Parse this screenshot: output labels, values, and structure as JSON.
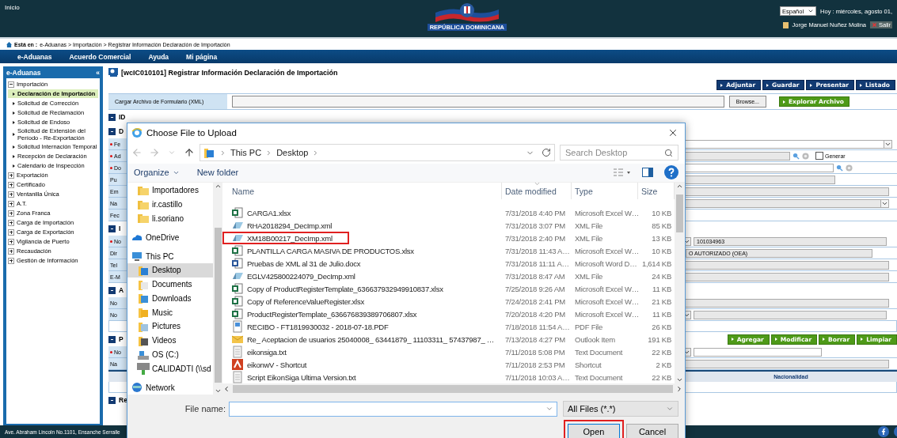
{
  "header": {
    "home": "Inicio",
    "logo_text": "REPÚBLICA DOMINICANA",
    "language": "Español",
    "date": "Hoy : miércoles, agosto 01,",
    "user": "Jorge Manuel Nuñez Molina",
    "logout": "Salir"
  },
  "breadcrumb": {
    "label": "Está en :",
    "path": "e-Aduanas > Importación > Registrar Información Declaración de Importación"
  },
  "menu": [
    "e-Aduanas",
    "Acuerdo Comercial",
    "Ayuda",
    "Mi página"
  ],
  "sidebar": {
    "title": "e-Aduanas",
    "collapse": "«",
    "items": [
      {
        "label": "Importación",
        "expanded": true,
        "children": [
          {
            "label": "Declaración de Importación",
            "selected": true
          },
          {
            "label": "Solicitud de Corrección",
            "selected": false
          },
          {
            "label": "Solicitud de Reclamación",
            "selected": false
          },
          {
            "label": "Solicitud de Endoso",
            "selected": false
          },
          {
            "label": "Solicitud de Extensión del Período - Re-Exportación",
            "selected": false
          },
          {
            "label": "Solicitud Internación Temporal",
            "selected": false
          },
          {
            "label": "Recepción de Declaración",
            "selected": false
          },
          {
            "label": "Calendario de Inspección",
            "selected": false
          }
        ]
      },
      {
        "label": "Exportación",
        "expanded": false
      },
      {
        "label": "Certificado",
        "expanded": false
      },
      {
        "label": "Ventanilla Única",
        "expanded": false
      },
      {
        "label": "A.T.",
        "expanded": false
      },
      {
        "label": "Zona Franca",
        "expanded": false
      },
      {
        "label": "Carga de Importación",
        "expanded": false
      },
      {
        "label": "Carga de Exportación",
        "expanded": false
      },
      {
        "label": "Vigilancia de Puerto",
        "expanded": false
      },
      {
        "label": "Recaudación",
        "expanded": false
      },
      {
        "label": "Gestión de Información",
        "expanded": false
      }
    ]
  },
  "page": {
    "title": "[wcIC010101] Registrar Información Declaración de Importación",
    "actions": [
      "Adjuntar",
      "Guardar",
      "Presentar",
      "Listado"
    ],
    "upload": {
      "label": "Cargar Archivo de Formulario (XML)",
      "browse": "Browse...",
      "explore": "Explorar Archivo"
    },
    "sections": [
      {
        "title": "ID"
      },
      {
        "title": "D",
        "rows": [
          {
            "label": "Fe",
            "required": true,
            "kind": "select"
          },
          {
            "label": "Ad",
            "required": true,
            "kind": "lookup",
            "generate": {
              "label": "Generar",
              "checked": false
            }
          },
          {
            "label": "Do",
            "required": true,
            "kind": "lookup-input"
          },
          {
            "label": "Pu",
            "required": false,
            "kind": "readonly-short"
          },
          {
            "label": "Em",
            "required": false,
            "kind": "readonly"
          },
          {
            "label": "Na",
            "required": false,
            "kind": "select-grey"
          },
          {
            "label": "Fec",
            "required": false,
            "kind": "date"
          }
        ]
      },
      {
        "title": "I",
        "rows": [
          {
            "label": "No",
            "required": true,
            "kind": "select-input",
            "value": "101034963"
          },
          {
            "label": "Dir",
            "required": false,
            "kind": "text",
            "value": "O AUTORIZADO (OEA)"
          },
          {
            "label": "Tel",
            "required": false,
            "kind": "readonly"
          },
          {
            "label": "E-M",
            "required": false,
            "kind": "readonly"
          }
        ]
      },
      {
        "title": "A",
        "rows": [
          {
            "label": "No",
            "required": false,
            "kind": "readonly"
          },
          {
            "label": "No",
            "required": false,
            "kind": "select-input-grey"
          },
          {
            "kind": "table-empty"
          }
        ]
      },
      {
        "title": "P",
        "buttons": [
          "Agregar",
          "Modificar",
          "Borrar",
          "Limpiar"
        ],
        "rows": [
          {
            "label": "No",
            "required": true,
            "kind": "select-input-white"
          },
          {
            "label": "Na",
            "required": false,
            "kind": "readonly"
          },
          {
            "kind": "grid-header",
            "columns": [
              "Nacionalidad"
            ]
          },
          {
            "kind": "table-empty"
          }
        ]
      },
      {
        "title": "Re"
      }
    ]
  },
  "footer": {
    "address": "Ave. Abraham Lincoln No.1101, Ensanche Serralle"
  },
  "dialog": {
    "title": "Choose File to Upload",
    "path": [
      "This PC",
      "Desktop"
    ],
    "search_placeholder": "Search Desktop",
    "organize": "Organize",
    "new_folder": "New folder",
    "nav_items": [
      {
        "label": "Importadores",
        "kind": "pinned-folder"
      },
      {
        "label": "ir.castillo",
        "kind": "pinned-folder"
      },
      {
        "label": "li.soriano",
        "kind": "pinned-folder"
      },
      {
        "label": "OneDrive",
        "kind": "cloud",
        "selected": false
      },
      {
        "label": "This PC",
        "kind": "computer",
        "selected": false,
        "children": [
          {
            "label": "Desktop",
            "kind": "desktop",
            "selected": true
          },
          {
            "label": "Documents",
            "kind": "documents",
            "selected": false
          },
          {
            "label": "Downloads",
            "kind": "downloads",
            "selected": false
          },
          {
            "label": "Music",
            "kind": "music",
            "selected": false
          },
          {
            "label": "Pictures",
            "kind": "pictures",
            "selected": false
          },
          {
            "label": "Videos",
            "kind": "videos",
            "selected": false
          },
          {
            "label": "OS (C:)",
            "kind": "drive",
            "selected": false
          },
          {
            "label": "CALIDADTI (\\\\sd",
            "kind": "network-drive",
            "selected": false
          }
        ]
      },
      {
        "label": "Network",
        "kind": "network",
        "selected": false
      }
    ],
    "columns": [
      {
        "label": "Name",
        "sorted": false
      },
      {
        "label": "Date modified",
        "sorted": true
      },
      {
        "label": "Type",
        "sorted": false
      },
      {
        "label": "Size",
        "sorted": false
      }
    ],
    "files": [
      {
        "name": "CARGA1.xlsx",
        "date": "7/31/2018 4:40 PM",
        "type": "Microsoft Excel W…",
        "size": "10 KB",
        "kind": "excel",
        "highlighted": false
      },
      {
        "name": "RHA2018294_DecImp.xml",
        "date": "7/31/2018 3:07 PM",
        "type": "XML File",
        "size": "85 KB",
        "kind": "xml",
        "highlighted": false
      },
      {
        "name": "XM18B00217_DecImp.xml",
        "date": "7/31/2018 2:40 PM",
        "type": "XML File",
        "size": "13 KB",
        "kind": "xml",
        "highlighted": true
      },
      {
        "name": "PLANTILLA CARGA MASIVA DE PRODUCTOS.xlsx",
        "date": "7/31/2018 11:43 A…",
        "type": "Microsoft Excel W…",
        "size": "10 KB",
        "kind": "excel",
        "highlighted": false
      },
      {
        "name": "Pruebas de XML al 31 de Julio.docx",
        "date": "7/31/2018 11:11 A…",
        "type": "Microsoft Word D…",
        "size": "1,614 KB",
        "kind": "word",
        "highlighted": false
      },
      {
        "name": "EGLV425800224079_DecImp.xml",
        "date": "7/31/2018 8:47 AM",
        "type": "XML File",
        "size": "24 KB",
        "kind": "xml",
        "highlighted": false
      },
      {
        "name": "Copy of ProductRegisterTemplate_636637932949910837.xlsx",
        "date": "7/25/2018 9:26 AM",
        "type": "Microsoft Excel W…",
        "size": "11 KB",
        "kind": "excel",
        "highlighted": false
      },
      {
        "name": "Copy of ReferenceValueRegister.xlsx",
        "date": "7/24/2018 2:41 PM",
        "type": "Microsoft Excel W…",
        "size": "21 KB",
        "kind": "excel",
        "highlighted": false
      },
      {
        "name": "ProductRegisterTemplate_636676839389706807.xlsx",
        "date": "7/20/2018 4:20 PM",
        "type": "Microsoft Excel W…",
        "size": "11 KB",
        "kind": "excel",
        "highlighted": false
      },
      {
        "name": "RECIBO - FT1819930032 -  2018-07-18.PDF",
        "date": "7/18/2018 11:54 A…",
        "type": "PDF File",
        "size": "26 KB",
        "kind": "pdf",
        "highlighted": false
      },
      {
        "name": "Re_ Aceptacion de usuarios 25040008_ 63441879_ 11103311_ 57437987_ …",
        "date": "7/13/2018 4:27 PM",
        "type": "Outlook Item",
        "size": "191 KB",
        "kind": "mail",
        "highlighted": false
      },
      {
        "name": "eikonsiga.txt",
        "date": "7/11/2018 5:08 PM",
        "type": "Text Document",
        "size": "22 KB",
        "kind": "text",
        "highlighted": false
      },
      {
        "name": "eikonwV - Shortcut",
        "date": "7/11/2018 2:53 PM",
        "type": "Shortcut",
        "size": "2 KB",
        "kind": "shortcut",
        "highlighted": false
      },
      {
        "name": "Script EikonSiga Ultima Version.txt",
        "date": "7/11/2018 10:03 A…",
        "type": "Text Document",
        "size": "22 KB",
        "kind": "text",
        "highlighted": false
      }
    ],
    "file_name_label": "File name:",
    "file_type": "All Files (*.*)",
    "buttons": [
      {
        "label": "Open",
        "highlighted": true
      },
      {
        "label": "Cancel",
        "highlighted": false
      }
    ]
  }
}
